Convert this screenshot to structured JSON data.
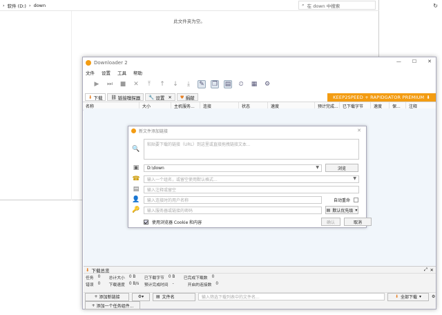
{
  "explorer": {
    "breadcrumb": [
      "软件 (D:)",
      "down"
    ],
    "search_placeholder": "在 down 中搜索",
    "empty_message": "此文件夹为空。"
  },
  "idm": {
    "title": "Downloader 2",
    "menu": [
      "文件",
      "设置",
      "工具",
      "帮助"
    ],
    "tabs": [
      "下载",
      "链接嗅探器",
      "设置",
      "捐献"
    ],
    "promo": "KEEP2SPEED + RAPIDGATOR PREMIUM",
    "columns": [
      "名称",
      "大小",
      "主机服务...",
      "连接",
      "状态",
      "速度",
      "预计完成...",
      "已下载字节",
      "速度",
      "保...",
      "注释"
    ],
    "dialog": {
      "title": "新文件添加链接",
      "url_placeholder": "粘贴要下载的链接（URL）到这里或直接拖拽链接文本...",
      "save_path": "D:\\down",
      "browse": "浏览",
      "category_placeholder": "输入一个组名，或留空使用默认格式...",
      "comment_placeholder": "输入注释或留空",
      "user_placeholder": "输入连接时的用户名称",
      "auto_rename": "自动重命",
      "pass_placeholder": "输入服务器或链接的密码",
      "priority": "默认优先级",
      "cookie_label": "使用浏览器 Cookie 和内容",
      "ok": "确认",
      "cancel": "取消"
    },
    "summary": {
      "title": "下载总览",
      "row1": [
        "任务",
        "0",
        "总计大小",
        "0 B",
        "已下载字节",
        "0 B",
        "已完成下载数",
        "0"
      ],
      "row2": [
        "错误",
        "0",
        "下载速度",
        "0 B/s",
        "预计完成时间",
        "-",
        "开启的连接数",
        "0"
      ]
    },
    "statusbar": {
      "add_link": "添加新链接",
      "filename": "文件名",
      "filter_placeholder": "输入筛选下载列表中的文件名...",
      "download_all": "全部下载",
      "add_batch": "添加一个任务组件..."
    }
  }
}
